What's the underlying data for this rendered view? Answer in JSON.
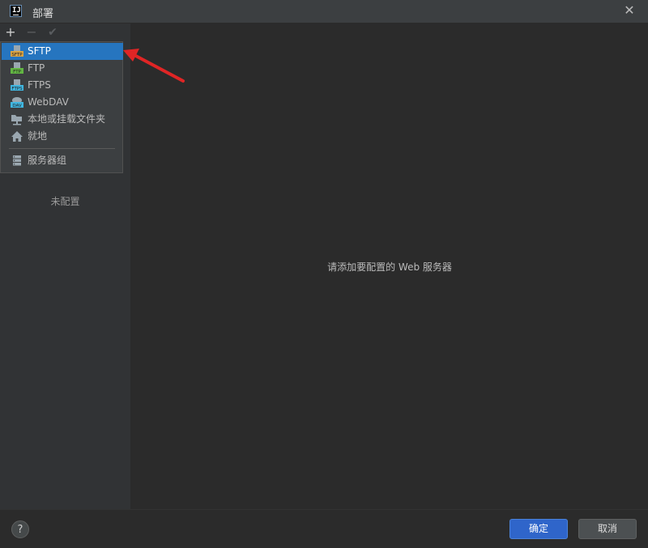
{
  "window": {
    "title": "部署",
    "close_icon": "close-icon",
    "app_icon_text": "IJ"
  },
  "toolbar": {
    "add_icon": "plus-icon",
    "remove_icon": "minus-icon",
    "check_icon": "check-icon"
  },
  "left_panel": {
    "empty_label": "未配置"
  },
  "right_panel": {
    "hint": "请添加要配置的 Web 服务器"
  },
  "menu": {
    "items": [
      {
        "label": "SFTP",
        "icon": "sftp-icon",
        "selected": true
      },
      {
        "label": "FTP",
        "icon": "ftp-icon"
      },
      {
        "label": "FTPS",
        "icon": "ftps-icon"
      },
      {
        "label": "WebDAV",
        "icon": "webdav-icon"
      },
      {
        "label": "本地或挂载文件夹",
        "icon": "folder-network-icon"
      },
      {
        "label": "就地",
        "icon": "home-icon"
      },
      {
        "label": "服务器组",
        "icon": "server-group-icon"
      }
    ],
    "icon_text": {
      "sftp": "SFTP",
      "ftp": "FTP",
      "ftps": "FTPS",
      "dav": "DAV"
    }
  },
  "footer": {
    "help_label": "?",
    "ok_label": "确定",
    "cancel_label": "取消"
  },
  "colors": {
    "selection": "#2675bf",
    "arrow": "#e02525",
    "ok_button": "#2f65ca"
  }
}
